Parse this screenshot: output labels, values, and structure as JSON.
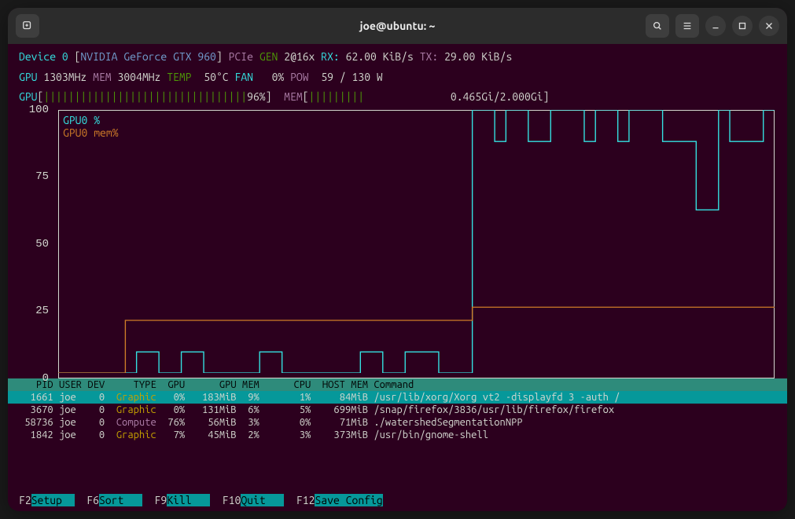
{
  "title": "joe@ubuntu: ~",
  "stats": {
    "device_label": "Device 0",
    "device_name": "NVIDIA GeForce GTX 960",
    "bus": "PCIe",
    "gen_label": "GEN",
    "gen_val": "2@16x",
    "rx_label": "RX:",
    "rx_val": "62.00 KiB/s",
    "tx_label": "TX:",
    "tx_val": "29.00 KiB/s",
    "gpu_label": "GPU",
    "gpu_clock": "1303MHz",
    "mem_label": "MEM",
    "mem_clock": "3004MHz",
    "temp_label": "TEMP",
    "temp_val": "50",
    "temp_unit": "°C",
    "fan_label": "FAN",
    "fan_val": "0%",
    "pow_label": "POW",
    "pow_val": "59 / 130 W",
    "gpu_bar_pct": "96%",
    "mem_bar_used": "0.465Gi",
    "mem_bar_total": "2.000Gi"
  },
  "chart_data": {
    "type": "line",
    "ylim": [
      0,
      100
    ],
    "y_ticks": [
      0,
      25,
      50,
      75,
      100
    ],
    "series": [
      {
        "name": "GPU0  %",
        "color": "#34e2e2",
        "values": [
          0,
          0,
          0,
          0,
          0,
          0,
          0,
          8,
          8,
          0,
          0,
          8,
          8,
          0,
          0,
          0,
          0,
          0,
          8,
          8,
          0,
          0,
          0,
          0,
          0,
          0,
          0,
          8,
          8,
          0,
          0,
          8,
          8,
          8,
          0,
          0,
          0,
          100,
          100,
          88,
          100,
          100,
          88,
          88,
          100,
          100,
          100,
          88,
          100,
          100,
          88,
          100,
          100,
          100,
          88,
          88,
          88,
          62,
          62,
          100,
          88,
          88,
          88,
          100,
          100
        ]
      },
      {
        "name": "GPU0  mem%",
        "color": "#ce7c28",
        "values": [
          0,
          0,
          0,
          0,
          0,
          0,
          20,
          20,
          20,
          20,
          20,
          20,
          20,
          20,
          20,
          20,
          20,
          20,
          20,
          20,
          20,
          20,
          20,
          20,
          20,
          20,
          20,
          20,
          20,
          20,
          20,
          20,
          20,
          20,
          20,
          20,
          20,
          25,
          25,
          25,
          25,
          25,
          25,
          25,
          25,
          25,
          25,
          25,
          25,
          25,
          25,
          25,
          25,
          25,
          25,
          25,
          25,
          25,
          25,
          25,
          25,
          25,
          25,
          25,
          25
        ]
      }
    ]
  },
  "proc": {
    "headers": [
      "PID",
      "USER",
      "DEV",
      "TYPE",
      "GPU",
      "GPU MEM",
      "CPU",
      "HOST MEM",
      "Command"
    ],
    "rows": [
      {
        "pid": "1661",
        "user": "joe",
        "dev": "0",
        "type": "Graphic",
        "gpu": "0%",
        "gmem": "183MiB",
        "gmempct": "9%",
        "cpu": "1%",
        "hmem": "84MiB",
        "cmd": "/usr/lib/xorg/Xorg vt2 -displayfd 3 -auth /",
        "sel": true
      },
      {
        "pid": "3670",
        "user": "joe",
        "dev": "0",
        "type": "Graphic",
        "gpu": "0%",
        "gmem": "131MiB",
        "gmempct": "6%",
        "cpu": "5%",
        "hmem": "699MiB",
        "cmd": "/snap/firefox/3836/usr/lib/firefox/firefox",
        "sel": false
      },
      {
        "pid": "58736",
        "user": "joe",
        "dev": "0",
        "type": "Compute",
        "gpu": "76%",
        "gmem": "56MiB",
        "gmempct": "3%",
        "cpu": "0%",
        "hmem": "71MiB",
        "cmd": "./watershedSegmentationNPP",
        "sel": false
      },
      {
        "pid": "1842",
        "user": "joe",
        "dev": "0",
        "type": "Graphic",
        "gpu": "7%",
        "gmem": "45MiB",
        "gmempct": "2%",
        "cpu": "3%",
        "hmem": "373MiB",
        "cmd": "/usr/bin/gnome-shell",
        "sel": false
      }
    ]
  },
  "fkeys": [
    {
      "key": "F2",
      "label": "Setup  "
    },
    {
      "key": "F6",
      "label": "Sort   "
    },
    {
      "key": "F9",
      "label": "Kill   "
    },
    {
      "key": "F10",
      "label": "Quit   "
    },
    {
      "key": "F12",
      "label": "Save Config"
    }
  ]
}
